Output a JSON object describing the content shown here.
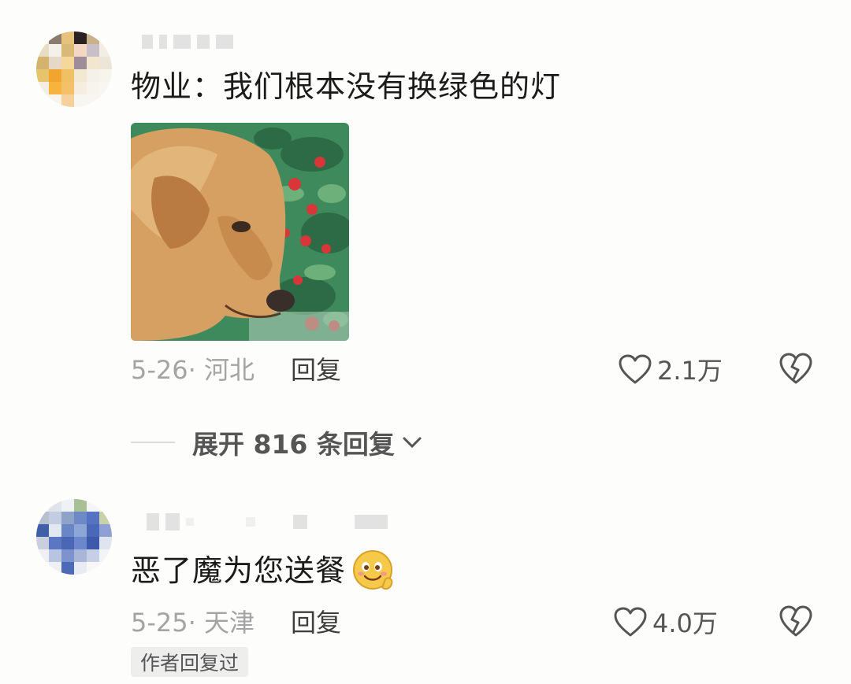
{
  "comments": [
    {
      "username": "",
      "text": "物业：我们根本没有换绿色的灯",
      "date_location": "5-26· 河北",
      "reply_label": "回复",
      "likes": "2.1万"
    },
    {
      "username": "",
      "text": "恶了魔为您送餐",
      "date_location": "5-25· 天津",
      "reply_label": "回复",
      "likes": "4.0万",
      "author_badge": "作者回复过"
    }
  ],
  "expand_replies": "展开 816 条回复",
  "icons": {
    "like": "heart-outline-icon",
    "dislike": "broken-heart-icon",
    "expand": "chevron-down-icon",
    "emoji": "smiling-face-emoji"
  },
  "colors": {
    "background": "#fdfdfb",
    "text_primary": "#1b1b1b",
    "text_meta": "#a4a4a4",
    "badge_bg": "#eeeeee"
  }
}
